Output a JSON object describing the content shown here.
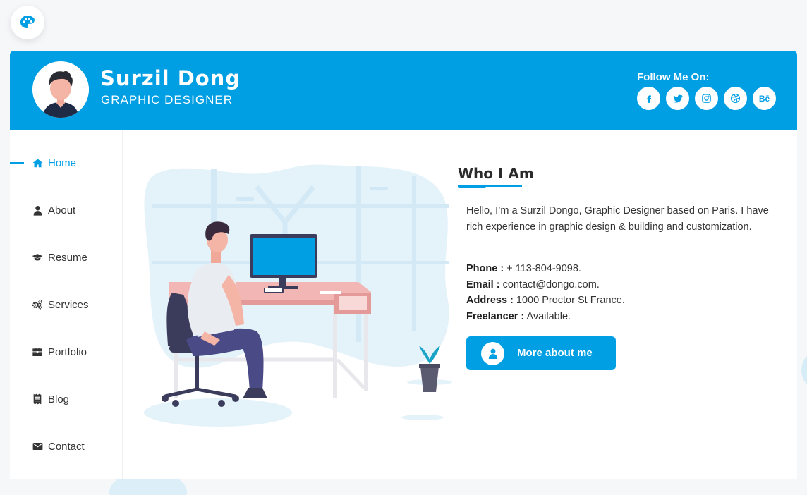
{
  "colors": {
    "accent": "#009ee3",
    "background": "#f6f7f9",
    "card": "#ffffff"
  },
  "palette_button": {
    "icon": "palette-icon"
  },
  "header": {
    "name": "Surzil Dong",
    "role": "GRAPHIC DESIGNER",
    "follow_label": "Follow Me On:",
    "socials": [
      {
        "icon": "facebook-icon",
        "glyph": "f"
      },
      {
        "icon": "twitter-icon",
        "glyph": ""
      },
      {
        "icon": "instagram-icon",
        "glyph": ""
      },
      {
        "icon": "dribbble-icon",
        "glyph": ""
      },
      {
        "icon": "behance-icon",
        "glyph": "Bē"
      }
    ]
  },
  "sidebar": {
    "items": [
      {
        "label": "Home",
        "icon": "home-icon",
        "active": true
      },
      {
        "label": "About",
        "icon": "user-icon",
        "active": false
      },
      {
        "label": "Resume",
        "icon": "graduation-cap-icon",
        "active": false
      },
      {
        "label": "Services",
        "icon": "gears-icon",
        "active": false
      },
      {
        "label": "Portfolio",
        "icon": "briefcase-icon",
        "active": false
      },
      {
        "label": "Blog",
        "icon": "receipt-icon",
        "active": false
      },
      {
        "label": "Contact",
        "icon": "envelope-icon",
        "active": false
      }
    ]
  },
  "main": {
    "title": "Who I Am",
    "intro": "Hello, I’m a Surzil Dongo, Graphic Designer based on Paris. I have rich experience in graphic design & building and customization.",
    "info": [
      {
        "label": "Phone :",
        "value": " + 113-804-9098."
      },
      {
        "label": "Email :",
        "value": " contact@dongo.com."
      },
      {
        "label": "Address :",
        "value": " 1000 Proctor St France."
      },
      {
        "label": "Freelancer :",
        "value": " Available."
      }
    ],
    "button_label": "More about me"
  }
}
